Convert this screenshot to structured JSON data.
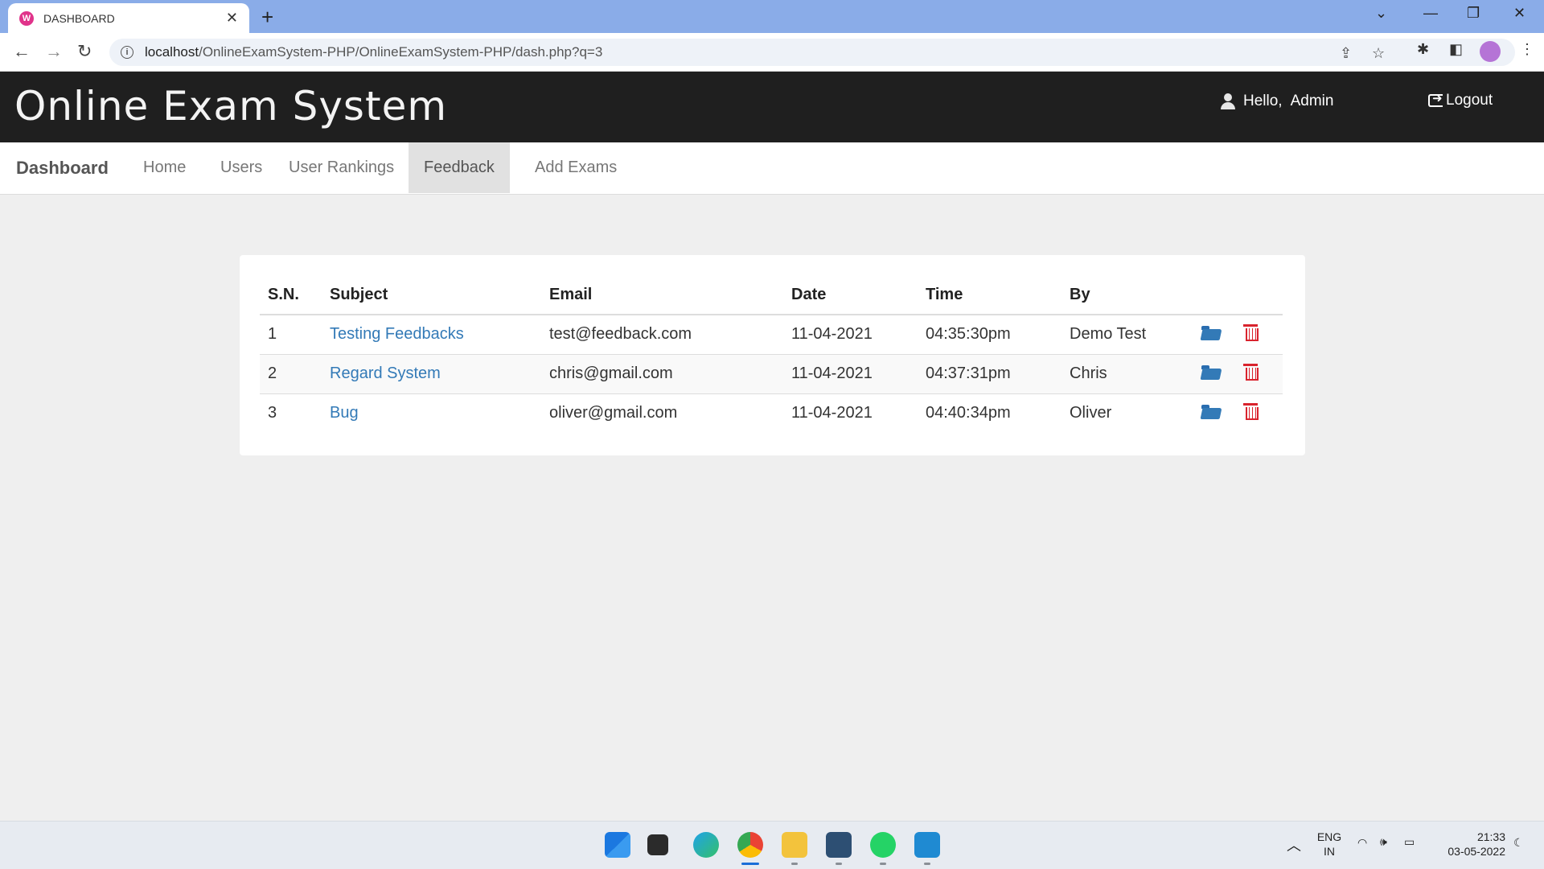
{
  "browser": {
    "tab_title": "DASHBOARD",
    "favicon_letter": "W",
    "url_host": "localhost",
    "url_path": "/OnlineExamSystem-PHP/OnlineExamSystem-PHP/dash.php?q=3"
  },
  "header": {
    "brand": "Online Exam System",
    "hello_label": "Hello,",
    "username": "Admin",
    "logout_label": "Logout"
  },
  "nav": {
    "brand": "Dashboard",
    "items": [
      {
        "label": "Home"
      },
      {
        "label": "Users"
      },
      {
        "label": "User Rankings"
      },
      {
        "label": "Feedback",
        "active": true
      },
      {
        "label": "Add Exams"
      }
    ]
  },
  "feedback_table": {
    "headers": [
      "S.N.",
      "Subject",
      "Email",
      "Date",
      "Time",
      "By"
    ],
    "rows": [
      {
        "sn": "1",
        "subject": "Testing Feedbacks",
        "email": "test@feedback.com",
        "date": "11-04-2021",
        "time": "04:35:30pm",
        "by": "Demo Test"
      },
      {
        "sn": "2",
        "subject": "Regard System",
        "email": "chris@gmail.com",
        "date": "11-04-2021",
        "time": "04:37:31pm",
        "by": "Chris"
      },
      {
        "sn": "3",
        "subject": "Bug",
        "email": "oliver@gmail.com",
        "date": "11-04-2021",
        "time": "04:40:34pm",
        "by": "Oliver"
      }
    ]
  },
  "taskbar": {
    "lang_line1": "ENG",
    "lang_line2": "IN",
    "time": "21:33",
    "date": "03-05-2022"
  },
  "colors": {
    "header_bg": "#1f1f1f",
    "link": "#337ab7",
    "delete": "#d9232d",
    "tabstrip": "#8aace8"
  }
}
